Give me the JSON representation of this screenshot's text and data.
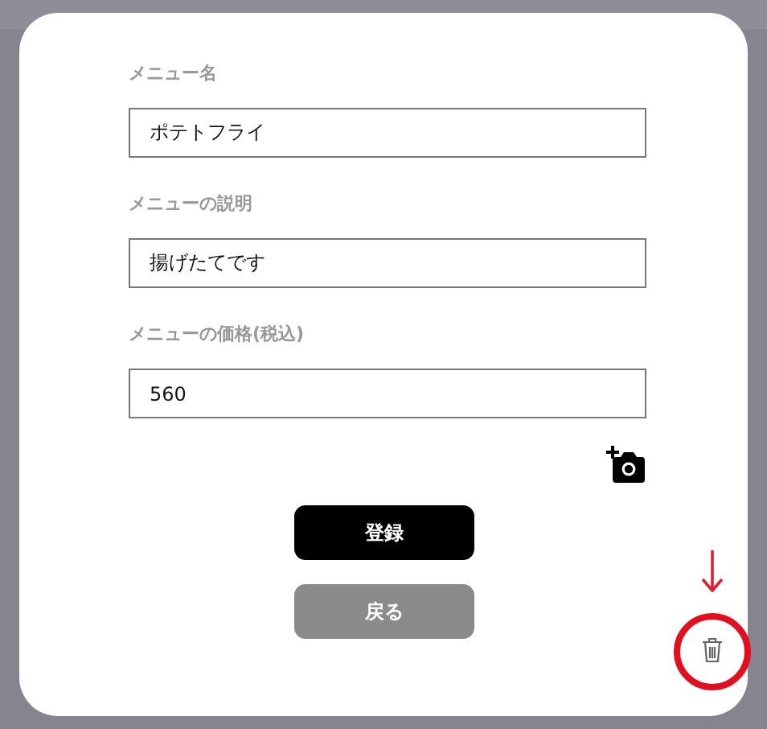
{
  "form": {
    "fields": [
      {
        "label": "メニュー名",
        "value": "ポテトフライ"
      },
      {
        "label": "メニューの説明",
        "value": "揚げたてです"
      },
      {
        "label": "メニューの価格(税込)",
        "value": "560"
      }
    ]
  },
  "buttons": [
    {
      "label": "登録",
      "kind": "primary"
    },
    {
      "label": "戻る",
      "kind": "secondary"
    }
  ]
}
